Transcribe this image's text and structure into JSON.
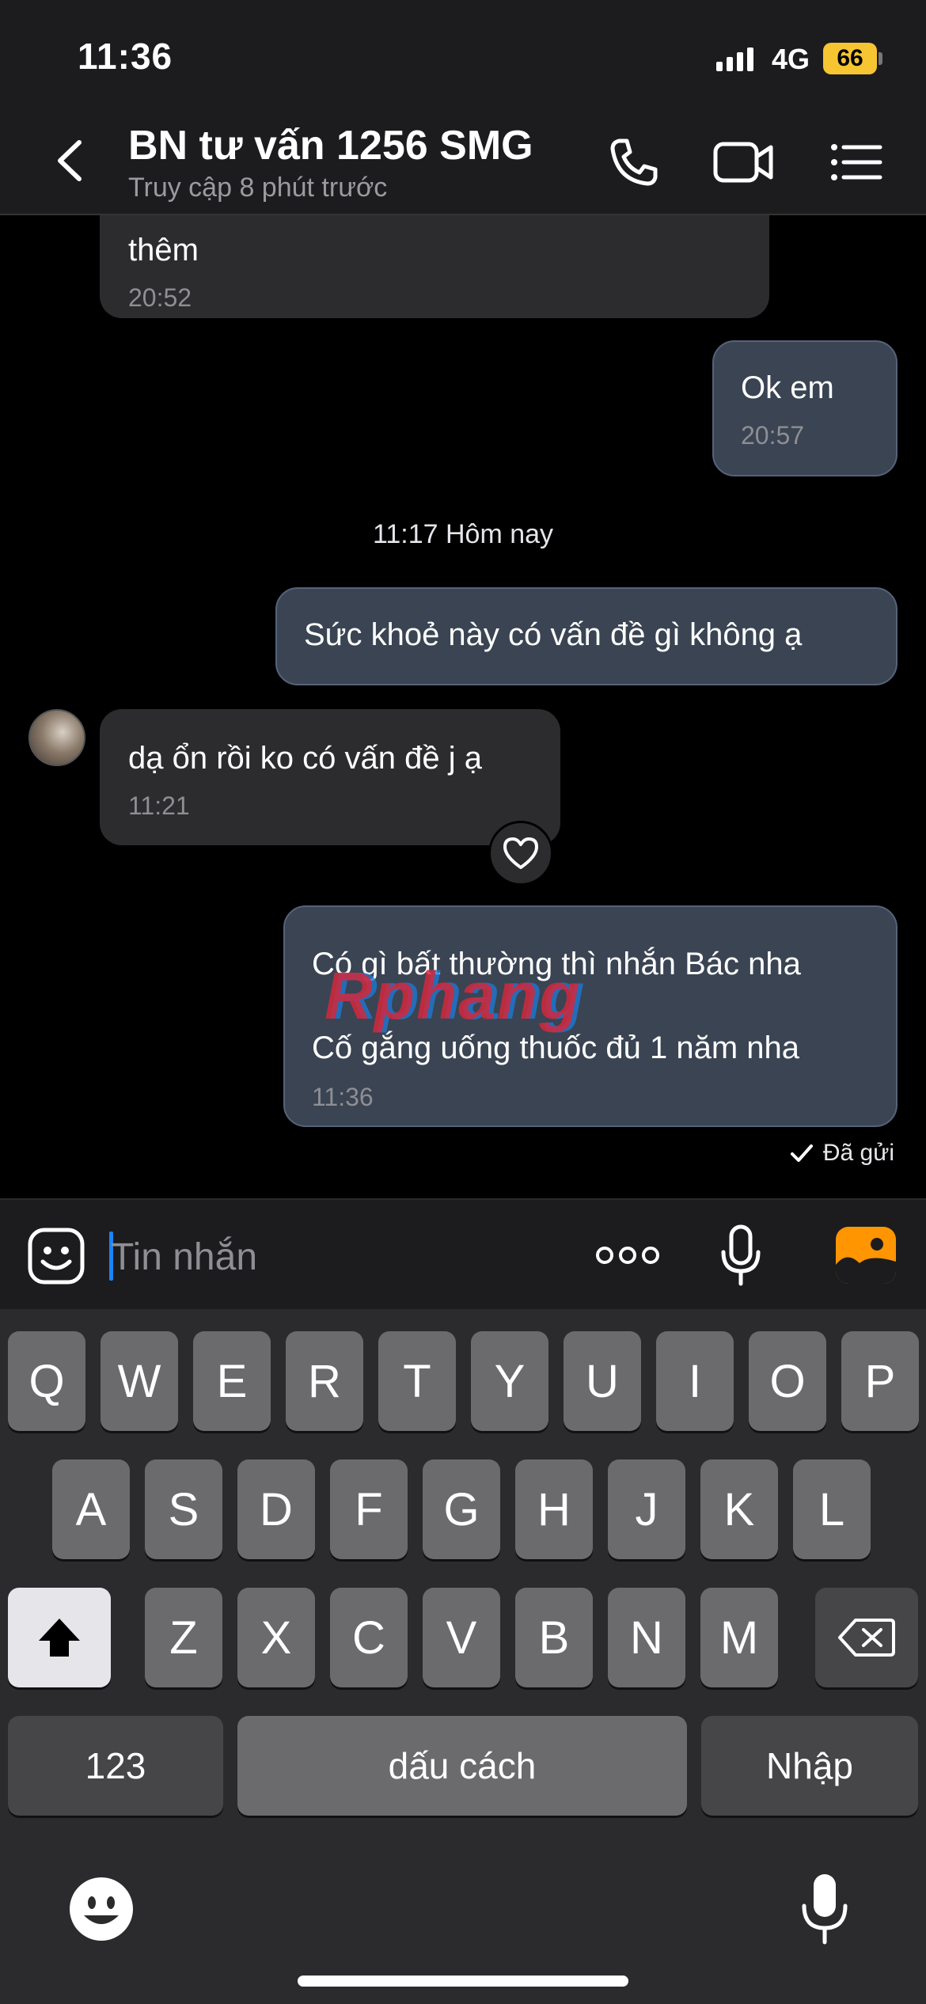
{
  "status_bar": {
    "time": "11:36",
    "network": "4G",
    "battery": "66"
  },
  "header": {
    "title": "BN tư vấn 1256 SMG",
    "subtitle": "Truy cập 8 phút trước",
    "icons": [
      "back-chevron-icon",
      "phone-icon",
      "video-call-icon",
      "menu-list-icon"
    ]
  },
  "messages": [
    {
      "side": "received",
      "text": "thêm",
      "time": "20:52"
    },
    {
      "side": "sent",
      "text": "Ok em",
      "time": "20:57"
    },
    {
      "type": "date-separator",
      "text": "11:17 Hôm nay"
    },
    {
      "side": "sent",
      "text": "Sức khoẻ này có vấn đề gì không ạ"
    },
    {
      "side": "received",
      "text": "dạ ổn rồi ko có vấn đề j ạ",
      "time": "11:21"
    },
    {
      "side": "sent",
      "lines": [
        "Có gì bất thường thì nhắn Bác nha",
        "Cố gắng uống thuốc đủ 1 năm nha"
      ],
      "time": "11:36"
    }
  ],
  "watermark": "Rphang",
  "sent_status": "Đã gửi",
  "input_bar": {
    "placeholder": "Tin nhắn"
  },
  "keyboard": {
    "row1": [
      "Q",
      "W",
      "E",
      "R",
      "T",
      "Y",
      "U",
      "I",
      "O",
      "P"
    ],
    "row2": [
      "A",
      "S",
      "D",
      "F",
      "G",
      "H",
      "J",
      "K",
      "L"
    ],
    "row3": [
      "Z",
      "X",
      "C",
      "V",
      "B",
      "N",
      "M"
    ],
    "numbers_label": "123",
    "space_label": "dấu cách",
    "return_label": "Nhập"
  },
  "colors": {
    "sent_bubble": "#3a4453",
    "received_bubble": "#2c2c2e",
    "accent": "#1a84ff",
    "battery": "#f7c531",
    "photo_button": "#ff9500"
  }
}
